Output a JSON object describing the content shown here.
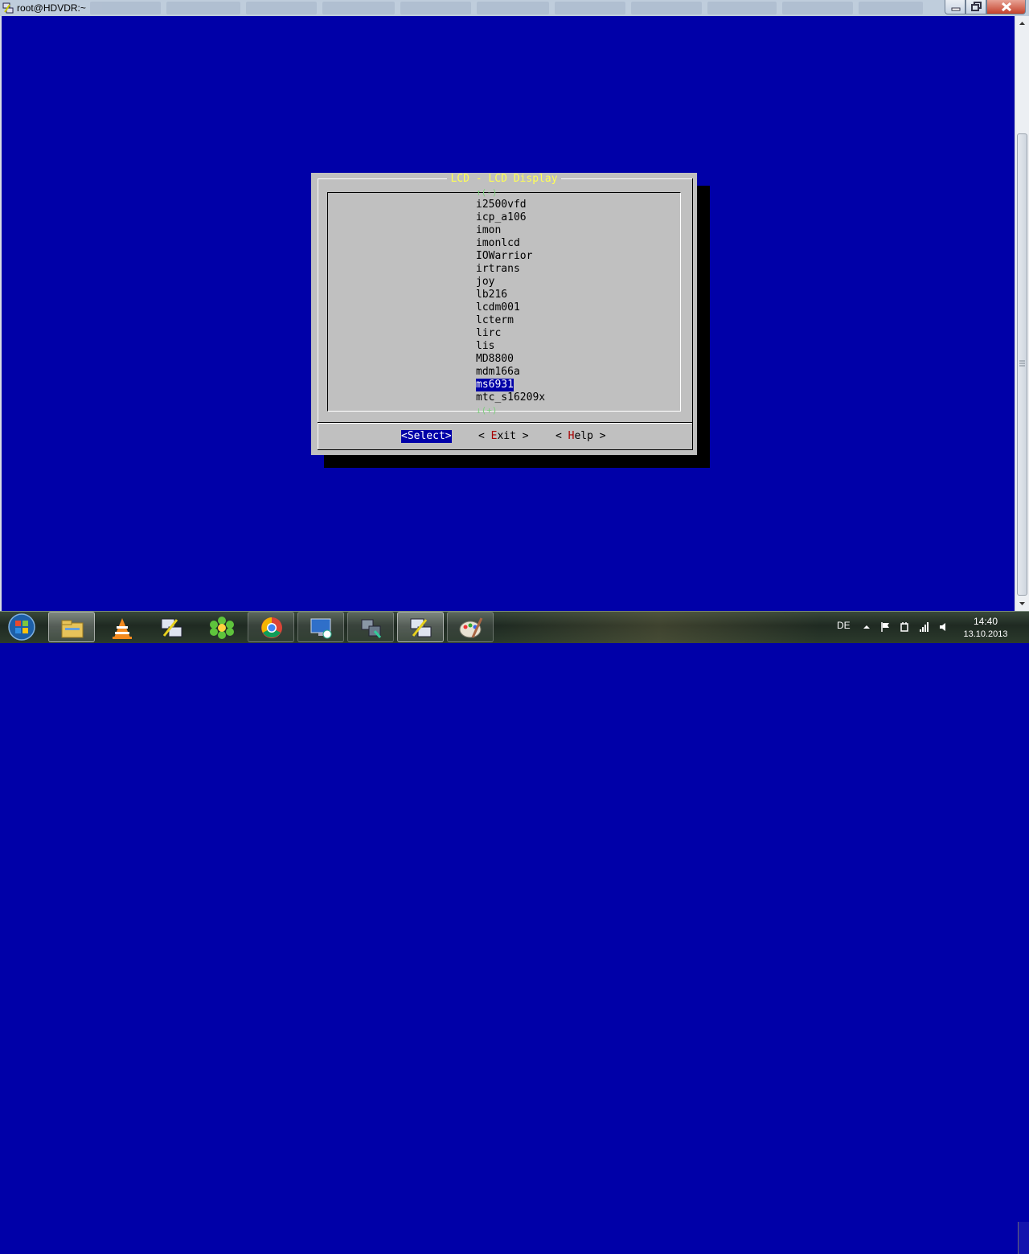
{
  "window": {
    "title": "root@HDVDR:~"
  },
  "dialog": {
    "title": "LCD - LCD Display",
    "scroll_up_indicator": "↑(-)",
    "scroll_down_indicator": "↓(+)",
    "items": [
      "i2500vfd",
      "icp_a106",
      "imon",
      "imonlcd",
      "IOWarrior",
      "irtrans",
      "joy",
      "lb216",
      "lcdm001",
      "lcterm",
      "lirc",
      "lis",
      "MD8800",
      "mdm166a",
      "ms6931",
      "mtc_s16209x"
    ],
    "selected_item": "ms6931",
    "buttons": {
      "select": "<Select>",
      "exit_open": "< ",
      "exit_hot": "E",
      "exit_rest": "xit >",
      "help_open": "< ",
      "help_hot": "H",
      "help_rest": "elp >"
    }
  },
  "taskbar": {
    "apps": [
      "windows-explorer-icon",
      "vlc-icon",
      "putty-icon",
      "icq-icon",
      "chrome-icon",
      "remote-desktop-icon",
      "network-tool-icon",
      "putty-icon",
      "paint-icon"
    ],
    "language": "DE",
    "time": "14:40",
    "date": "13.10.2013"
  },
  "colors": {
    "terminal_bg": "#0000a8",
    "dialog_bg": "#c0c0c0",
    "title_fg": "#ffff54",
    "hotkey": "#a80000"
  }
}
